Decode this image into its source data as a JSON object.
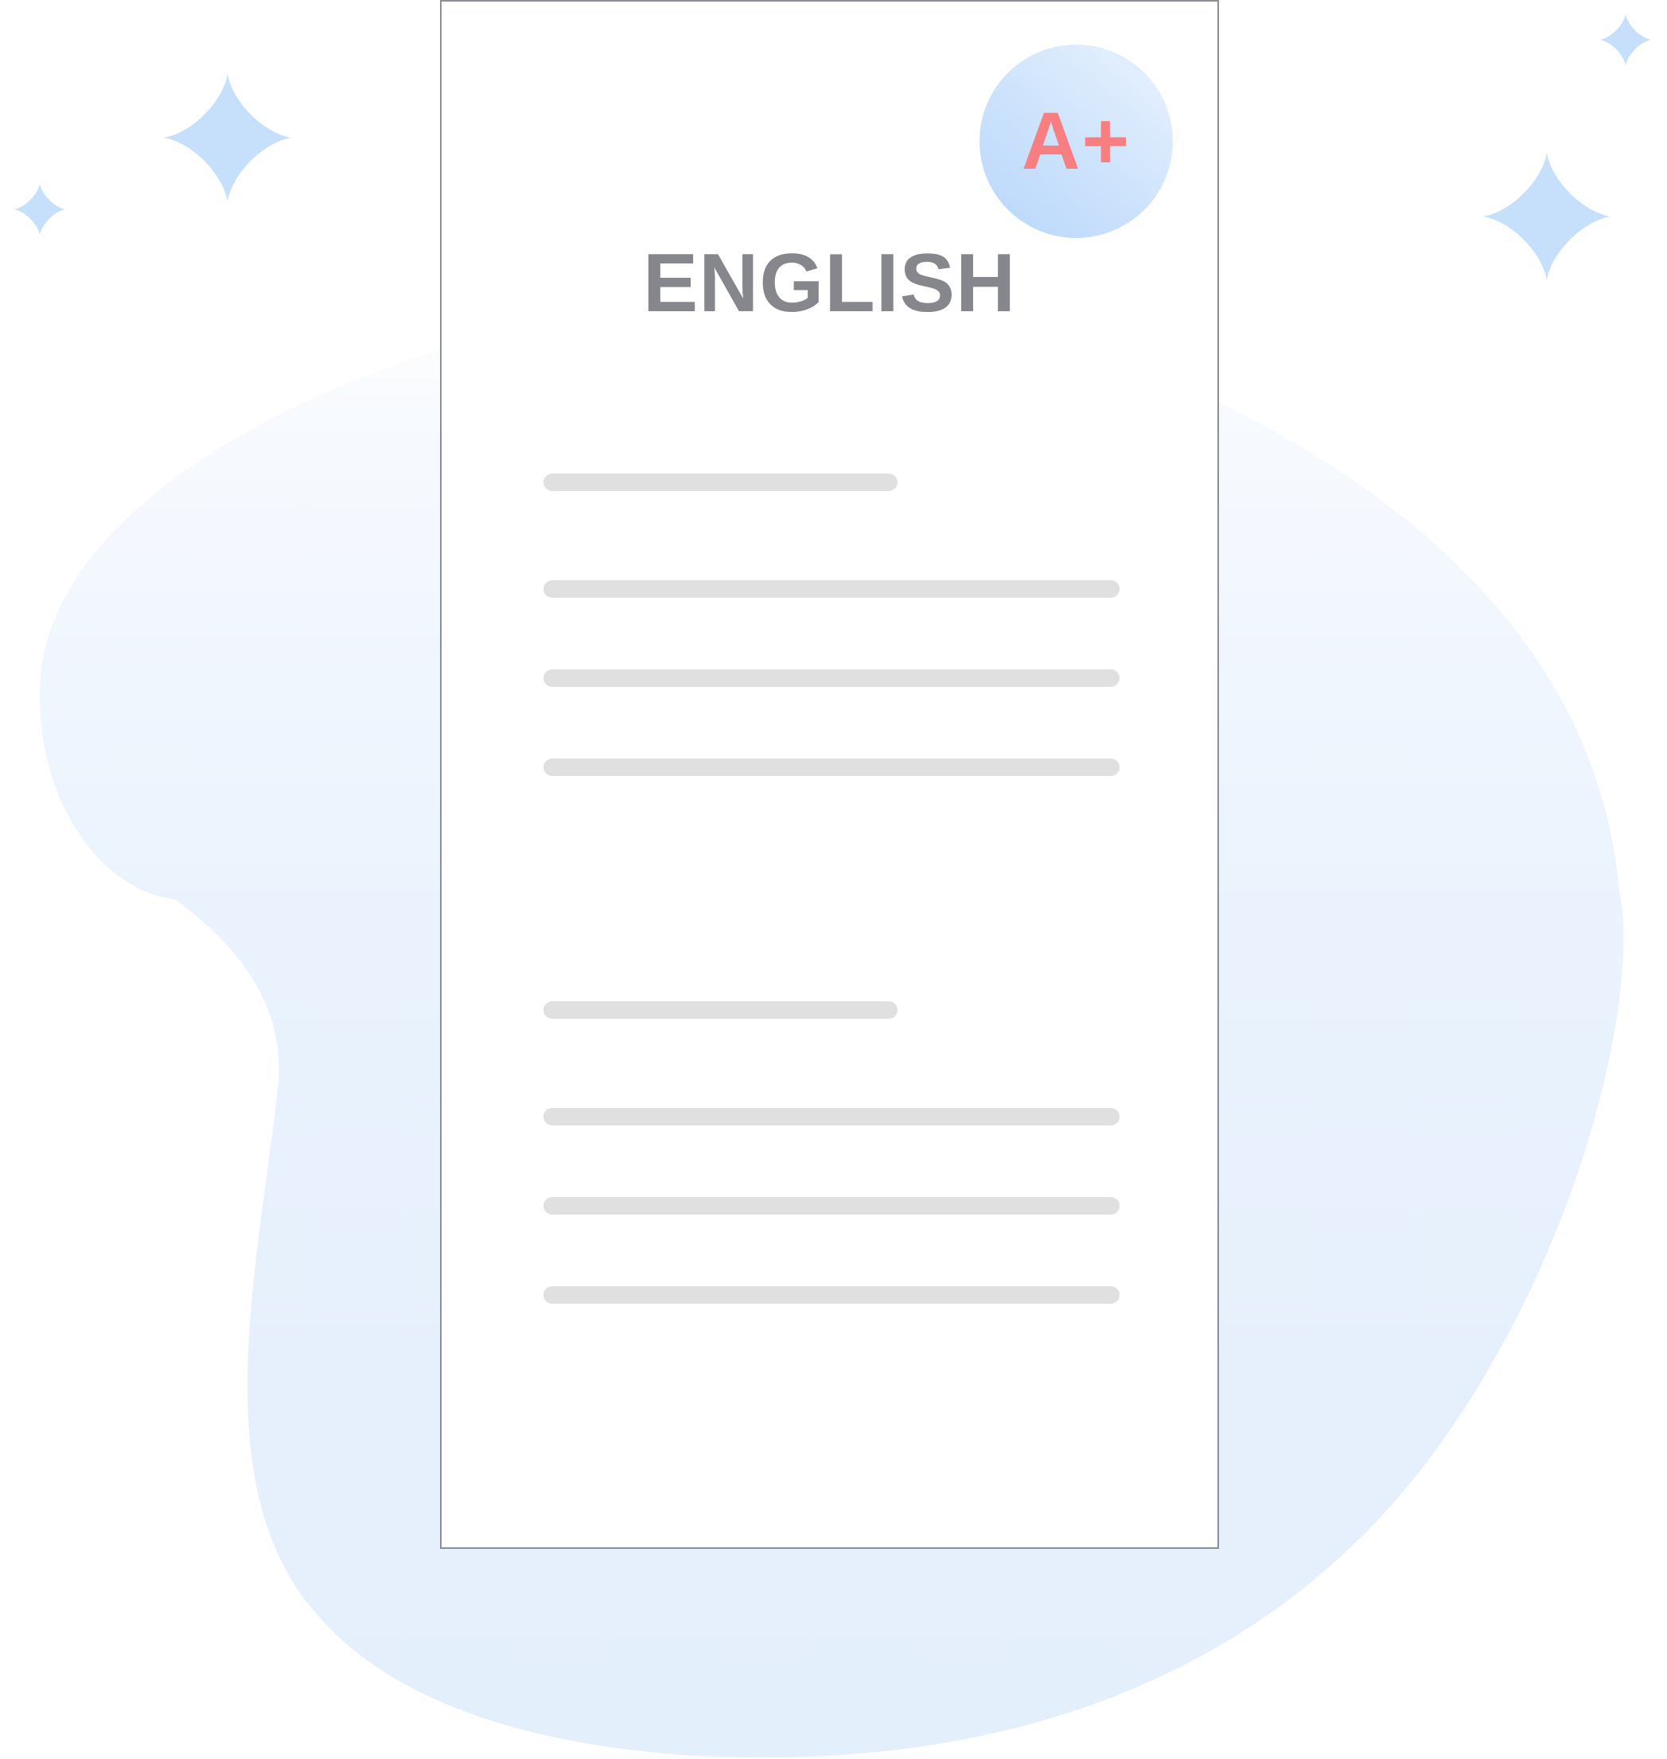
{
  "document": {
    "title": "ENGLISH",
    "grade": "A+"
  },
  "colors": {
    "blob_top": "#f7fafe",
    "blob_bottom": "#e4effc",
    "sparkle": "#c6e0fc",
    "title_text": "#86878c",
    "grade_text": "#f77f81",
    "placeholder_line": "#e0e0e0",
    "paper_border": "#8a8f98"
  },
  "icons": {
    "decorations": [
      "sparkle-icon"
    ]
  }
}
